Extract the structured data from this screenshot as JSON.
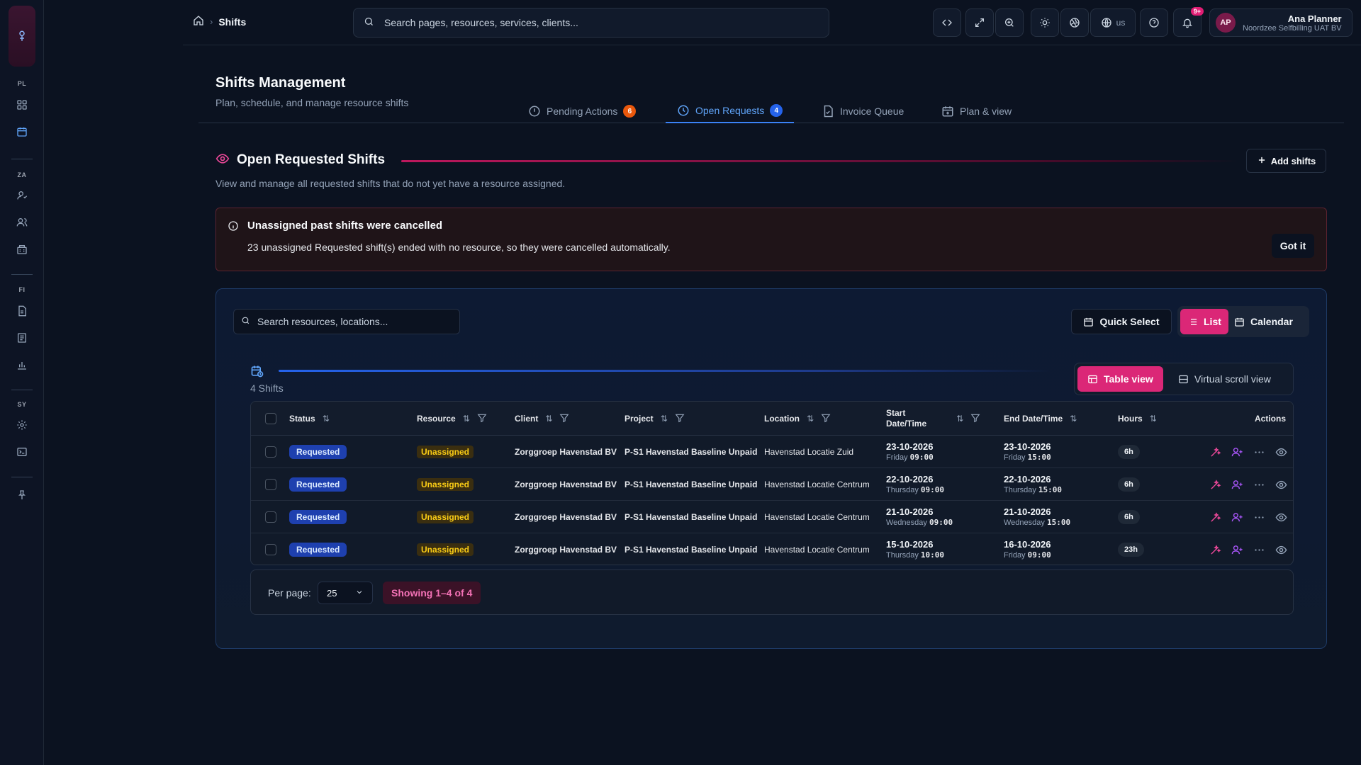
{
  "sidebar": {
    "sections": [
      {
        "label": "PL",
        "items": [
          "dashboard-icon",
          "calendar-icon"
        ]
      },
      {
        "label": "ZA",
        "items": [
          "user-icon",
          "users-icon",
          "building-icon"
        ]
      },
      {
        "label": "FI",
        "items": [
          "document-icon",
          "ledger-icon",
          "chart-icon"
        ]
      },
      {
        "label": "SY",
        "items": [
          "gear-icon",
          "terminal-icon"
        ]
      }
    ],
    "bottom_icon": "pin-icon"
  },
  "topbar": {
    "breadcrumb": {
      "home_icon": "home-icon",
      "current": "Shifts"
    },
    "search_placeholder": "Search pages, resources, services, clients...",
    "language": "us",
    "notifications_badge": "9+",
    "user": {
      "initials": "AP",
      "name": "Ana Planner",
      "org": "Noordzee Selfbilling UAT BV"
    }
  },
  "header": {
    "title": "Shifts Management",
    "subtitle": "Plan, schedule, and manage resource shifts",
    "tabs": [
      {
        "label": "Pending Actions",
        "count": "6",
        "icon": "alert-circle-icon",
        "active": false
      },
      {
        "label": "Open Requests",
        "count": "4",
        "icon": "clock-icon",
        "active": true
      },
      {
        "label": "Invoice Queue",
        "icon": "file-check-icon",
        "active": false
      },
      {
        "label": "Plan & view",
        "icon": "calendar-plus-icon",
        "active": false
      }
    ]
  },
  "section": {
    "title": "Open Requested Shifts",
    "description": "View and manage all requested shifts that do not yet have a resource assigned.",
    "add_button": "Add shifts"
  },
  "alert": {
    "title": "Unassigned past shifts were cancelled",
    "message": "23 unassigned Requested shift(s) ended with no resource, so they were cancelled automatically.",
    "button": "Got it"
  },
  "toolbar": {
    "search_placeholder": "Search resources, locations...",
    "quick_select": "Quick Select",
    "list": "List",
    "calendar": "Calendar",
    "table_view": "Table view",
    "virtual_scroll_view": "Virtual scroll view",
    "shifts_count": "4 Shifts"
  },
  "table": {
    "headers": {
      "status": "Status",
      "resource": "Resource",
      "client": "Client",
      "project": "Project",
      "location": "Location",
      "start_line1": "Start",
      "start_line2": "Date/Time",
      "end": "End Date/Time",
      "hours": "Hours",
      "actions": "Actions"
    },
    "rows": [
      {
        "status": "Requested",
        "resource": "Unassigned",
        "client": "Zorggroep Havenstad BV",
        "project": "P-S1 Havenstad Baseline Unpaid",
        "location": "Havenstad Locatie Zuid",
        "start_date": "23-10-2026",
        "start_day": "Friday",
        "start_time": "09:00",
        "end_date": "23-10-2026",
        "end_day": "Friday",
        "end_time": "15:00",
        "hours": "6h"
      },
      {
        "status": "Requested",
        "resource": "Unassigned",
        "client": "Zorggroep Havenstad BV",
        "project": "P-S1 Havenstad Baseline Unpaid",
        "location": "Havenstad Locatie Centrum",
        "start_date": "22-10-2026",
        "start_day": "Thursday",
        "start_time": "09:00",
        "end_date": "22-10-2026",
        "end_day": "Thursday",
        "end_time": "15:00",
        "hours": "6h"
      },
      {
        "status": "Requested",
        "resource": "Unassigned",
        "client": "Zorggroep Havenstad BV",
        "project": "P-S1 Havenstad Baseline Unpaid",
        "location": "Havenstad Locatie Centrum",
        "start_date": "21-10-2026",
        "start_day": "Wednesday",
        "start_time": "09:00",
        "end_date": "21-10-2026",
        "end_day": "Wednesday",
        "end_time": "15:00",
        "hours": "6h"
      },
      {
        "status": "Requested",
        "resource": "Unassigned",
        "client": "Zorggroep Havenstad BV",
        "project": "P-S1 Havenstad Baseline Unpaid",
        "location": "Havenstad Locatie Centrum",
        "start_date": "15-10-2026",
        "start_day": "Thursday",
        "start_time": "10:00",
        "end_date": "16-10-2026",
        "end_day": "Friday",
        "end_time": "09:00",
        "hours": "23h"
      }
    ]
  },
  "pagination": {
    "per_page_label": "Per page:",
    "per_page_value": "25",
    "showing": "Showing 1–4 of 4"
  },
  "colors": {
    "accent": "#db2777",
    "primary": "#3b82f6",
    "background": "#0b1220"
  }
}
